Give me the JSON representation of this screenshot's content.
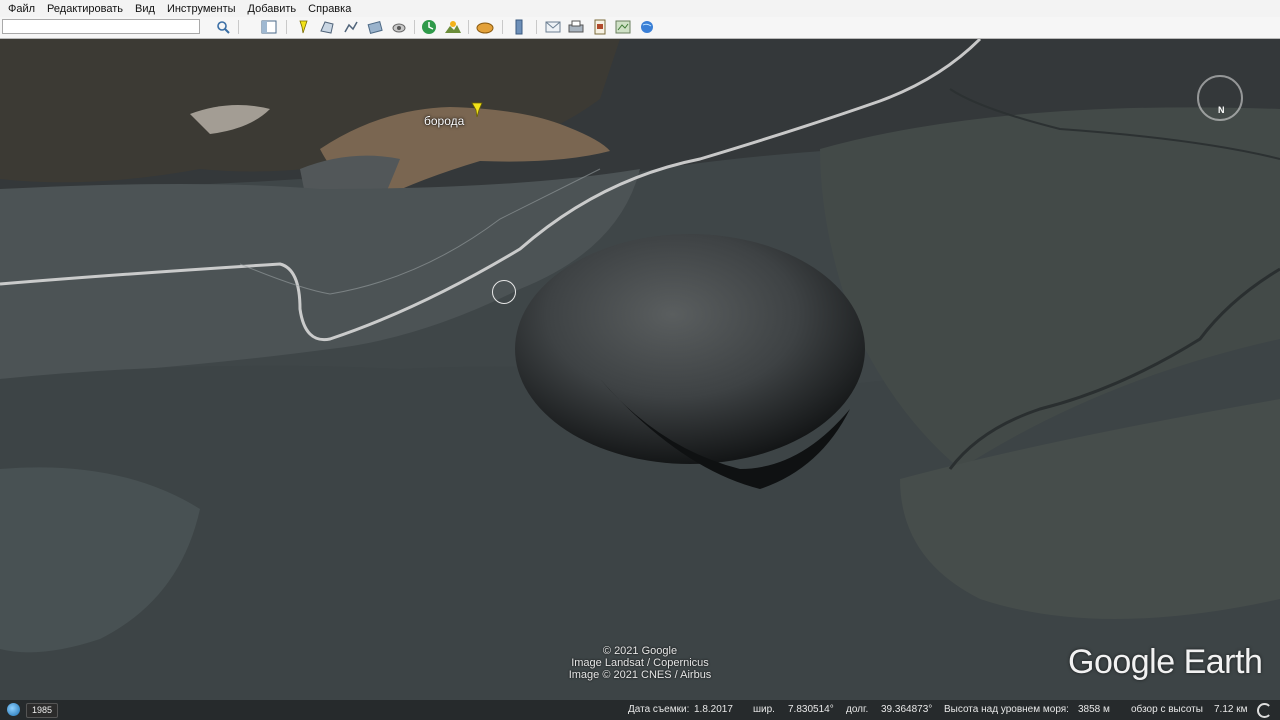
{
  "menu": {
    "items": [
      {
        "label": "Файл"
      },
      {
        "label": "Редактировать"
      },
      {
        "label": "Вид"
      },
      {
        "label": "Инструменты"
      },
      {
        "label": "Добавить"
      },
      {
        "label": "Справка"
      }
    ]
  },
  "toolbar": {
    "search_value": "",
    "icons": [
      "search-icon",
      "sidebar-toggle-icon",
      "placemark-icon",
      "polygon-icon",
      "path-icon",
      "overlay-icon",
      "tour-icon",
      "historical-imagery-icon",
      "sunlight-icon",
      "planets-icon",
      "ruler-icon",
      "email-icon",
      "print-icon",
      "save-image-icon",
      "view-in-maps-icon",
      "earth-gallery-icon"
    ]
  },
  "map": {
    "placemark_label": "борода",
    "attribution": [
      "© 2021 Google",
      "Image Landsat / Copernicus",
      "Image © 2021 CNES / Airbus"
    ],
    "logo": "Google Earth",
    "compass_label": "N"
  },
  "status": {
    "year": "1985",
    "imagery_date_label": "Дата съемки:",
    "imagery_date": "1.8.2017",
    "lat_label": "шир.",
    "lat": "7.830514°",
    "lon_label": "долг.",
    "lon": "39.364873°",
    "elev_label": "Высота над уровнем моря:",
    "elev": "3858 м",
    "eye_label": "обзор с высоты",
    "eye": "7.12 км"
  },
  "colors": {
    "placemark_pin": "#f2e21a",
    "road": "#d8d8d8",
    "terrain_dark": "#3a4143"
  }
}
